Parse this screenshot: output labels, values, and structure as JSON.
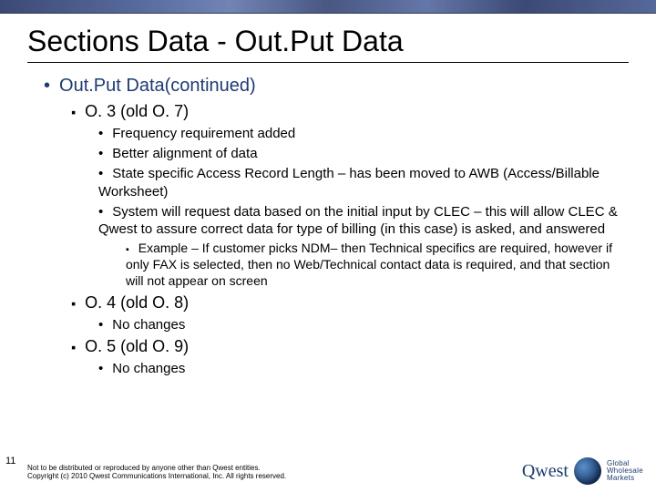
{
  "title": "Sections Data - Out.Put Data",
  "l1": {
    "label": "Out.Put Data(continued)"
  },
  "s1": {
    "heading": "O. 3 (old O. 7)",
    "b1": "Frequency requirement added",
    "b2": "Better alignment of data",
    "b3": "State specific Access Record Length – has been moved to AWB (Access/Billable Worksheet)",
    "b4": "System will request data based on the initial input by CLEC – this will allow CLEC & Qwest to assure correct data for type of billing (in this case) is asked, and answered",
    "ex": "Example – If customer picks NDM– then Technical specifics are required, however if only FAX is selected, then no Web/Technical contact data is required, and that section will not appear on screen"
  },
  "s2": {
    "heading": "O. 4 (old O. 8)",
    "b1": "No changes"
  },
  "s3": {
    "heading": "O. 5 (old O. 9)",
    "b1": "No changes"
  },
  "page_number": "11",
  "footer1": "Not to be distributed or reproduced by anyone other than Qwest entities.",
  "footer2": "Copyright (c) 2010 Qwest Communications International, Inc.  All rights reserved.",
  "logo": {
    "brand": "Qwest",
    "unit1": "Global",
    "unit2": "Wholesale",
    "unit3": "Markets"
  }
}
